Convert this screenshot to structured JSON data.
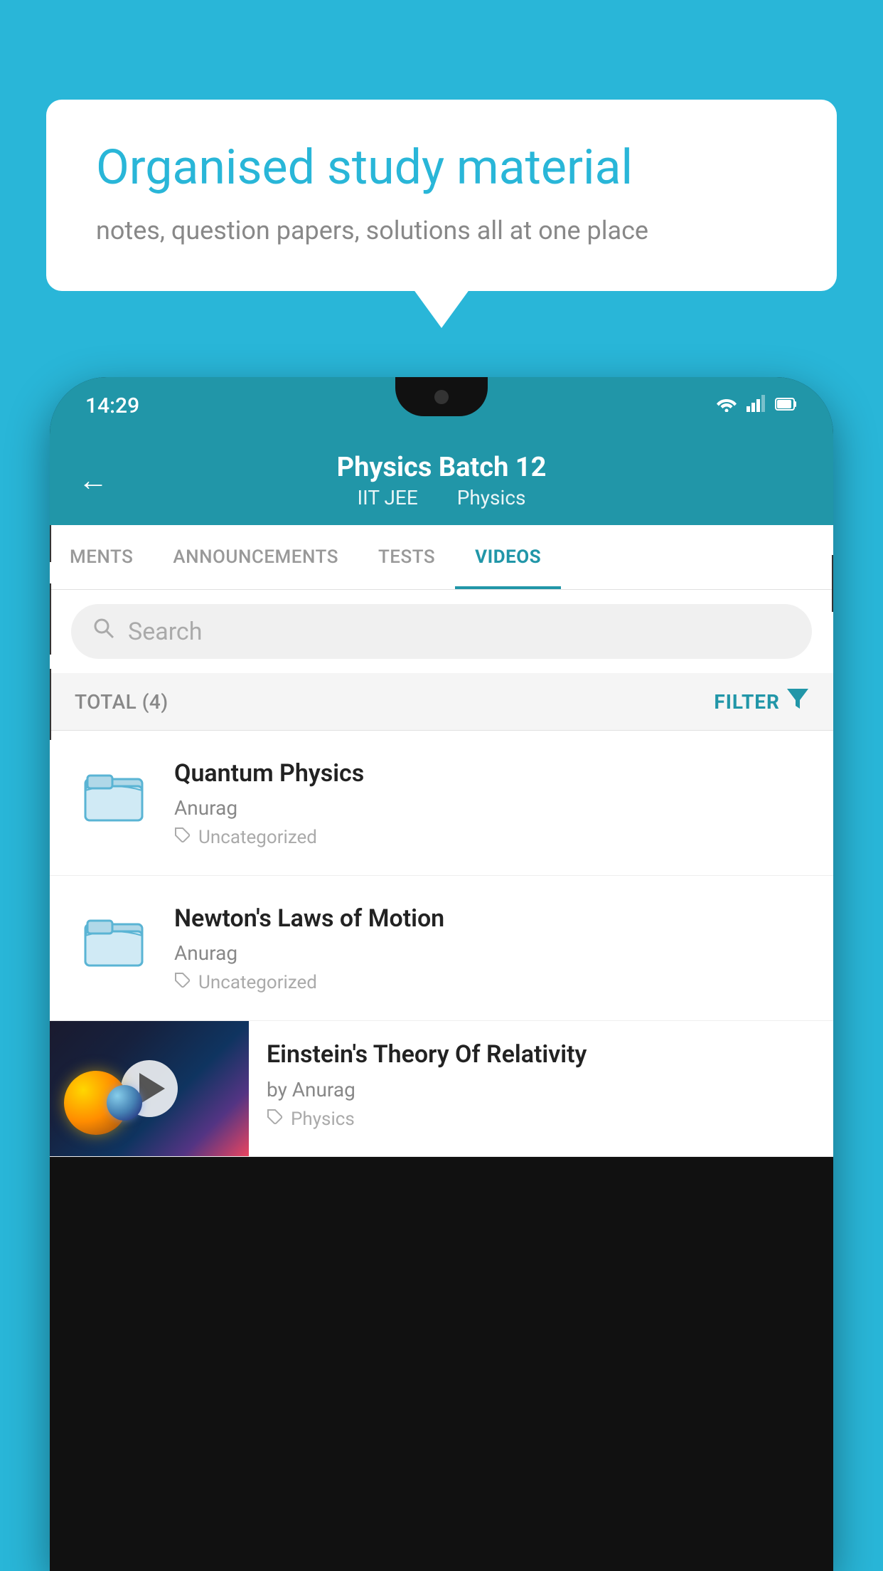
{
  "background_color": "#29b6d8",
  "speech_bubble": {
    "title": "Organised study material",
    "subtitle": "notes, question papers, solutions all at one place"
  },
  "status_bar": {
    "time": "14:29",
    "wifi": "▾",
    "signal": "▲",
    "battery": "▮"
  },
  "app_header": {
    "title": "Physics Batch 12",
    "subtitle_part1": "IIT JEE",
    "subtitle_part2": "Physics",
    "back_label": "←"
  },
  "tabs": [
    {
      "label": "MENTS",
      "active": false
    },
    {
      "label": "ANNOUNCEMENTS",
      "active": false
    },
    {
      "label": "TESTS",
      "active": false
    },
    {
      "label": "VIDEOS",
      "active": true
    }
  ],
  "search": {
    "placeholder": "Search"
  },
  "filter_bar": {
    "total_label": "TOTAL (4)",
    "filter_label": "FILTER"
  },
  "videos": [
    {
      "id": 1,
      "title": "Quantum Physics",
      "author": "Anurag",
      "tag": "Uncategorized",
      "has_thumbnail": false
    },
    {
      "id": 2,
      "title": "Newton's Laws of Motion",
      "author": "Anurag",
      "tag": "Uncategorized",
      "has_thumbnail": false
    },
    {
      "id": 3,
      "title": "Einstein's Theory Of Relativity",
      "author": "by Anurag",
      "tag": "Physics",
      "has_thumbnail": true
    }
  ]
}
